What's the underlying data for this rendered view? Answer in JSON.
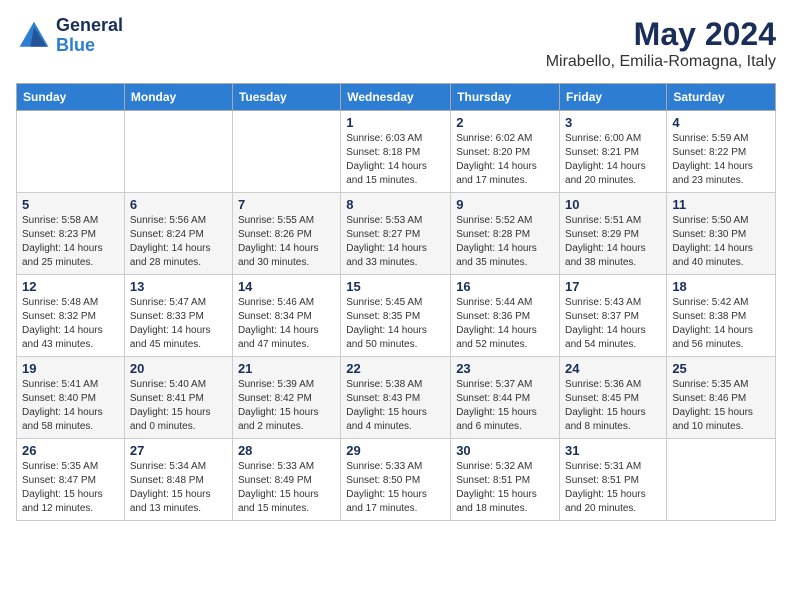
{
  "header": {
    "logo_general": "General",
    "logo_blue": "Blue",
    "month": "May 2024",
    "location": "Mirabello, Emilia-Romagna, Italy"
  },
  "weekdays": [
    "Sunday",
    "Monday",
    "Tuesday",
    "Wednesday",
    "Thursday",
    "Friday",
    "Saturday"
  ],
  "weeks": [
    [
      {
        "day": "",
        "info": ""
      },
      {
        "day": "",
        "info": ""
      },
      {
        "day": "",
        "info": ""
      },
      {
        "day": "1",
        "info": "Sunrise: 6:03 AM\nSunset: 8:18 PM\nDaylight: 14 hours\nand 15 minutes."
      },
      {
        "day": "2",
        "info": "Sunrise: 6:02 AM\nSunset: 8:20 PM\nDaylight: 14 hours\nand 17 minutes."
      },
      {
        "day": "3",
        "info": "Sunrise: 6:00 AM\nSunset: 8:21 PM\nDaylight: 14 hours\nand 20 minutes."
      },
      {
        "day": "4",
        "info": "Sunrise: 5:59 AM\nSunset: 8:22 PM\nDaylight: 14 hours\nand 23 minutes."
      }
    ],
    [
      {
        "day": "5",
        "info": "Sunrise: 5:58 AM\nSunset: 8:23 PM\nDaylight: 14 hours\nand 25 minutes."
      },
      {
        "day": "6",
        "info": "Sunrise: 5:56 AM\nSunset: 8:24 PM\nDaylight: 14 hours\nand 28 minutes."
      },
      {
        "day": "7",
        "info": "Sunrise: 5:55 AM\nSunset: 8:26 PM\nDaylight: 14 hours\nand 30 minutes."
      },
      {
        "day": "8",
        "info": "Sunrise: 5:53 AM\nSunset: 8:27 PM\nDaylight: 14 hours\nand 33 minutes."
      },
      {
        "day": "9",
        "info": "Sunrise: 5:52 AM\nSunset: 8:28 PM\nDaylight: 14 hours\nand 35 minutes."
      },
      {
        "day": "10",
        "info": "Sunrise: 5:51 AM\nSunset: 8:29 PM\nDaylight: 14 hours\nand 38 minutes."
      },
      {
        "day": "11",
        "info": "Sunrise: 5:50 AM\nSunset: 8:30 PM\nDaylight: 14 hours\nand 40 minutes."
      }
    ],
    [
      {
        "day": "12",
        "info": "Sunrise: 5:48 AM\nSunset: 8:32 PM\nDaylight: 14 hours\nand 43 minutes."
      },
      {
        "day": "13",
        "info": "Sunrise: 5:47 AM\nSunset: 8:33 PM\nDaylight: 14 hours\nand 45 minutes."
      },
      {
        "day": "14",
        "info": "Sunrise: 5:46 AM\nSunset: 8:34 PM\nDaylight: 14 hours\nand 47 minutes."
      },
      {
        "day": "15",
        "info": "Sunrise: 5:45 AM\nSunset: 8:35 PM\nDaylight: 14 hours\nand 50 minutes."
      },
      {
        "day": "16",
        "info": "Sunrise: 5:44 AM\nSunset: 8:36 PM\nDaylight: 14 hours\nand 52 minutes."
      },
      {
        "day": "17",
        "info": "Sunrise: 5:43 AM\nSunset: 8:37 PM\nDaylight: 14 hours\nand 54 minutes."
      },
      {
        "day": "18",
        "info": "Sunrise: 5:42 AM\nSunset: 8:38 PM\nDaylight: 14 hours\nand 56 minutes."
      }
    ],
    [
      {
        "day": "19",
        "info": "Sunrise: 5:41 AM\nSunset: 8:40 PM\nDaylight: 14 hours\nand 58 minutes."
      },
      {
        "day": "20",
        "info": "Sunrise: 5:40 AM\nSunset: 8:41 PM\nDaylight: 15 hours\nand 0 minutes."
      },
      {
        "day": "21",
        "info": "Sunrise: 5:39 AM\nSunset: 8:42 PM\nDaylight: 15 hours\nand 2 minutes."
      },
      {
        "day": "22",
        "info": "Sunrise: 5:38 AM\nSunset: 8:43 PM\nDaylight: 15 hours\nand 4 minutes."
      },
      {
        "day": "23",
        "info": "Sunrise: 5:37 AM\nSunset: 8:44 PM\nDaylight: 15 hours\nand 6 minutes."
      },
      {
        "day": "24",
        "info": "Sunrise: 5:36 AM\nSunset: 8:45 PM\nDaylight: 15 hours\nand 8 minutes."
      },
      {
        "day": "25",
        "info": "Sunrise: 5:35 AM\nSunset: 8:46 PM\nDaylight: 15 hours\nand 10 minutes."
      }
    ],
    [
      {
        "day": "26",
        "info": "Sunrise: 5:35 AM\nSunset: 8:47 PM\nDaylight: 15 hours\nand 12 minutes."
      },
      {
        "day": "27",
        "info": "Sunrise: 5:34 AM\nSunset: 8:48 PM\nDaylight: 15 hours\nand 13 minutes."
      },
      {
        "day": "28",
        "info": "Sunrise: 5:33 AM\nSunset: 8:49 PM\nDaylight: 15 hours\nand 15 minutes."
      },
      {
        "day": "29",
        "info": "Sunrise: 5:33 AM\nSunset: 8:50 PM\nDaylight: 15 hours\nand 17 minutes."
      },
      {
        "day": "30",
        "info": "Sunrise: 5:32 AM\nSunset: 8:51 PM\nDaylight: 15 hours\nand 18 minutes."
      },
      {
        "day": "31",
        "info": "Sunrise: 5:31 AM\nSunset: 8:51 PM\nDaylight: 15 hours\nand 20 minutes."
      },
      {
        "day": "",
        "info": ""
      }
    ]
  ]
}
